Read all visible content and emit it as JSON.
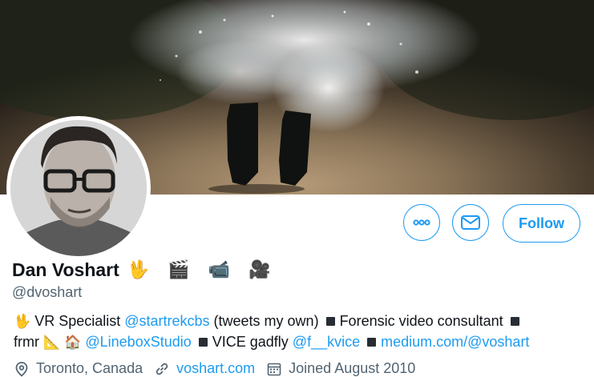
{
  "profile": {
    "name": "Dan Voshart",
    "name_emoji": "🖖 🎬 📹 🎥",
    "handle": "@dvoshart"
  },
  "actions": {
    "more_icon": "more-horizontal-icon",
    "message_icon": "envelope-icon",
    "follow_label": "Follow"
  },
  "bio": {
    "line1": {
      "emoji1": "🖖",
      "text1": "VR Specialist ",
      "link1": "@startrekcbs",
      "text2": " (tweets my own)",
      "text3": "Forensic video consultant"
    },
    "line2": {
      "text1": "frmr",
      "emoji1": "📐",
      "emoji2": "🏠",
      "link1": "@LineboxStudio",
      "text2": "VICE gadfly ",
      "link2": "@f__kvice",
      "link3": "medium.com/@voshart"
    }
  },
  "meta": {
    "location": "Toronto, Canada",
    "website": "voshart.com",
    "joined": "Joined August 2010"
  },
  "colors": {
    "accent": "#1d9bf0",
    "secondary_text": "#536471",
    "primary_text": "#0f1419"
  }
}
